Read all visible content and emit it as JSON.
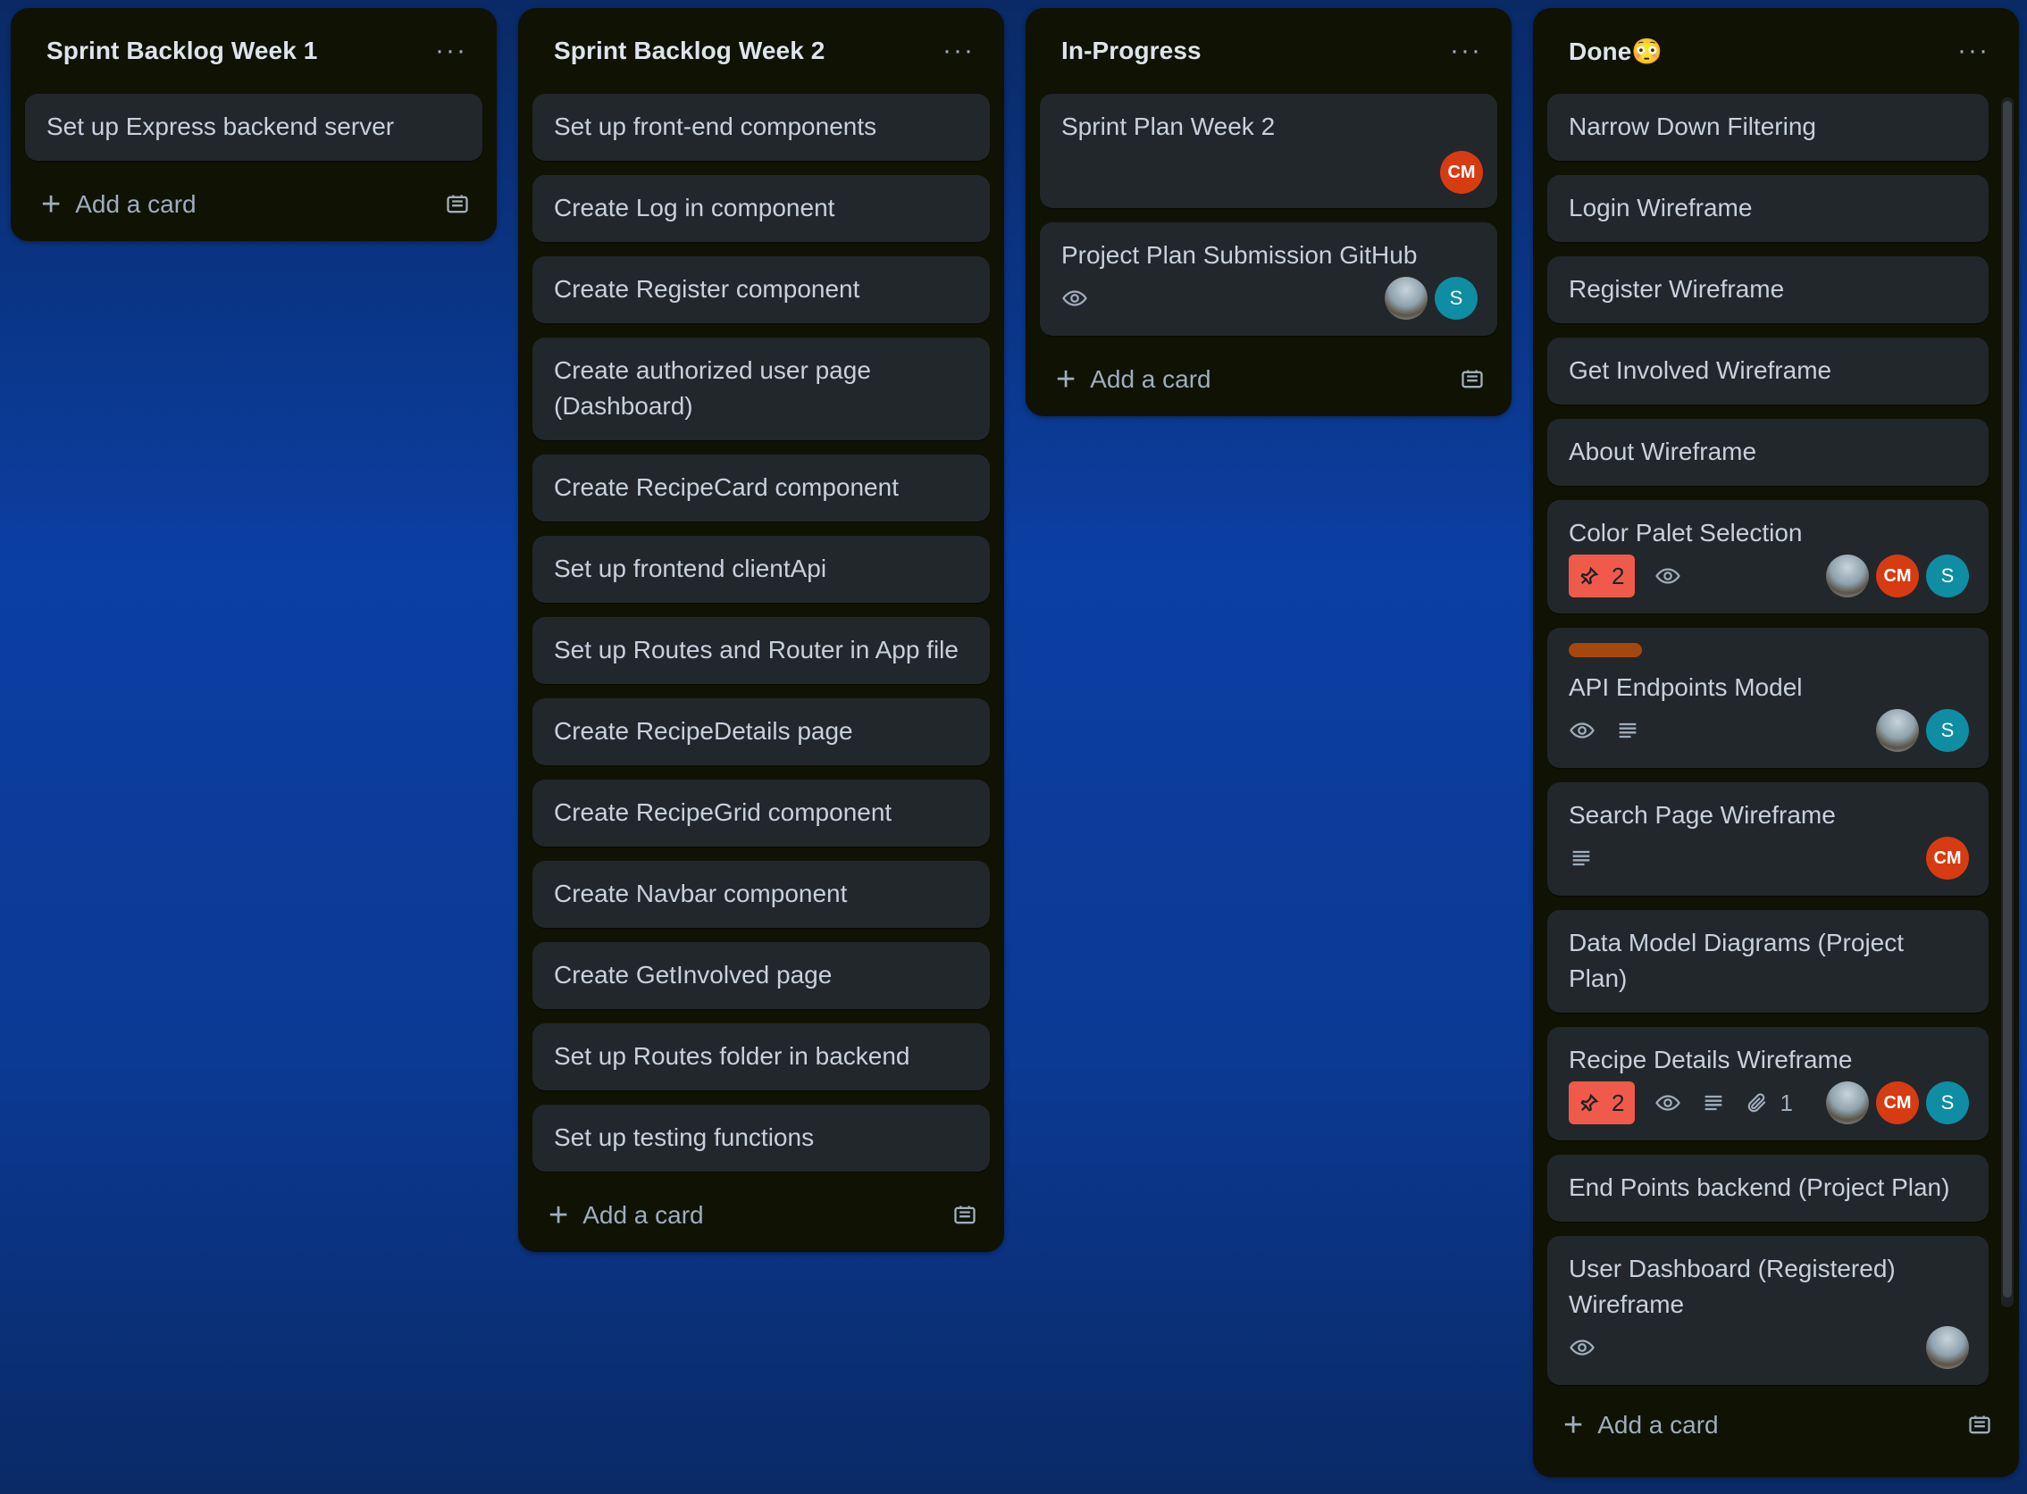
{
  "lists": [
    {
      "title": "Sprint Backlog Week 1",
      "menu": "···",
      "cards": [
        "Set up Express backend server"
      ],
      "add_label": "Add a card"
    },
    {
      "title": "Sprint Backlog Week 2",
      "menu": "···",
      "cards": [
        "Set up front-end components",
        "Create Log in component",
        "Create Register component",
        "Create authorized user page (Dashboard)",
        "Create RecipeCard component",
        "Set up frontend clientApi",
        "Set up Routes and Router in App file",
        "Create RecipeDetails page",
        "Create RecipeGrid component",
        "Create Navbar component",
        "Create GetInvolved page",
        "Set up Routes folder in backend",
        "Set up testing functions"
      ],
      "add_label": "Add a card"
    },
    {
      "title": "In-Progress",
      "menu": "···",
      "cards": [
        "Sprint Plan Week 2",
        "Project Plan Submission GitHub"
      ],
      "add_label": "Add a card"
    },
    {
      "title": "Done😳",
      "menu": "···",
      "cards": [
        "Narrow Down Filtering",
        "Login Wireframe",
        "Register Wireframe",
        "Get Involved Wireframe",
        "About Wireframe",
        "Color Palet Selection",
        "API Endpoints Model",
        "Search Page Wireframe",
        "Data Model Diagrams (Project Plan)",
        "Recipe Details Wireframe",
        "End Points backend (Project Plan)",
        "User Dashboard (Registered) Wireframe"
      ],
      "add_label": "Add a card"
    }
  ],
  "members": {
    "cm": "CM",
    "s": "S"
  },
  "badges": {
    "color_palet_votes": "2",
    "recipe_details_votes": "2",
    "recipe_details_attachments": "1"
  },
  "colors": {
    "list_bg": "#101204",
    "card_bg": "#22272b",
    "avatar_cm": "#d63b12",
    "avatar_s": "#0e8da3",
    "vote_badge": "#f05a4a",
    "label_orange": "#a5480f"
  }
}
